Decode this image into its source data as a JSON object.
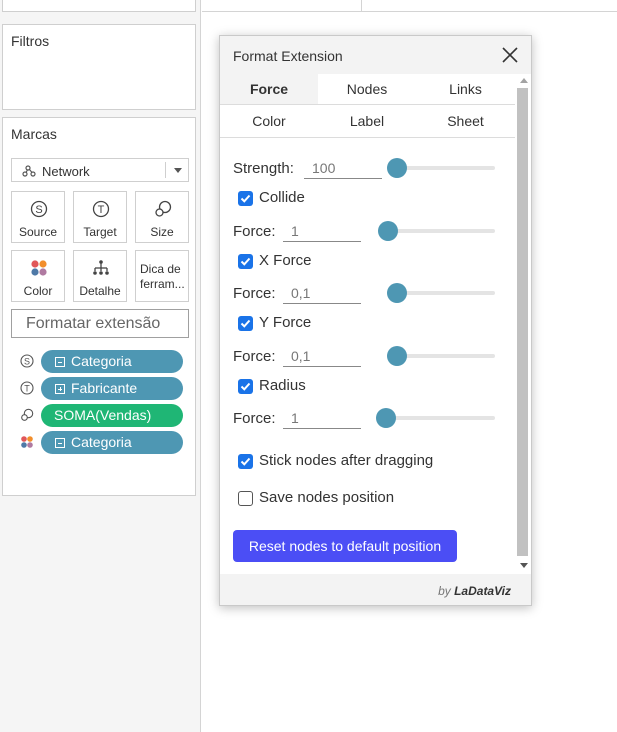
{
  "left_panel": {
    "filters_title": "Filtros",
    "marks_title": "Marcas",
    "mark_type": "Network",
    "shelves": [
      {
        "label": "Source",
        "icon": "source-icon"
      },
      {
        "label": "Target",
        "icon": "target-icon"
      },
      {
        "label": "Size",
        "icon": "size-icon"
      },
      {
        "label": "Color",
        "icon": "color-icon"
      },
      {
        "label": "Detalhe",
        "icon": "detail-icon"
      },
      {
        "label": "Dica de ferram...",
        "icon": "tooltip-icon"
      }
    ],
    "format_placeholder": "Formatar extensão",
    "pills": [
      {
        "label": "Categoria",
        "icon": "source-icon",
        "prefix": "minus",
        "color": "#4e97b3"
      },
      {
        "label": "Fabricante",
        "icon": "target-icon",
        "prefix": "plus",
        "color": "#4e97b3"
      },
      {
        "label": "SOMA(Vendas)",
        "icon": "size-icon",
        "prefix": "none",
        "color": "#1fb675"
      },
      {
        "label": "Categoria",
        "icon": "color-icon",
        "prefix": "minus",
        "color": "#4e97b3"
      }
    ]
  },
  "dialog": {
    "title": "Format Extension",
    "tabs_row1": [
      "Force",
      "Nodes",
      "Links"
    ],
    "tabs_row2": [
      "Color",
      "Label",
      "Sheet"
    ],
    "active_tab": "Force",
    "strength_label": "Strength:",
    "strength_value": "100",
    "force_label": "Force:",
    "collide": {
      "label": "Collide",
      "checked": true,
      "value": "1"
    },
    "x_force": {
      "label": "X Force",
      "checked": true,
      "value": "0,1"
    },
    "y_force": {
      "label": "Y Force",
      "checked": true,
      "value": "0,1"
    },
    "radius": {
      "label": "Radius",
      "checked": true,
      "value": "1"
    },
    "stick_nodes": {
      "label": "Stick nodes after dragging",
      "checked": true
    },
    "save_nodes": {
      "label": "Save nodes position",
      "checked": false
    },
    "reset_label": "Reset nodes to default position",
    "footer_by": "by",
    "footer_brand": "LaDataViz"
  },
  "colors": {
    "pill_blue": "#4e97b3",
    "pill_green": "#1fb675",
    "slider_thumb": "#4e97b3",
    "checkbox": "#1a73e8",
    "reset_button": "#4b4ef5"
  }
}
